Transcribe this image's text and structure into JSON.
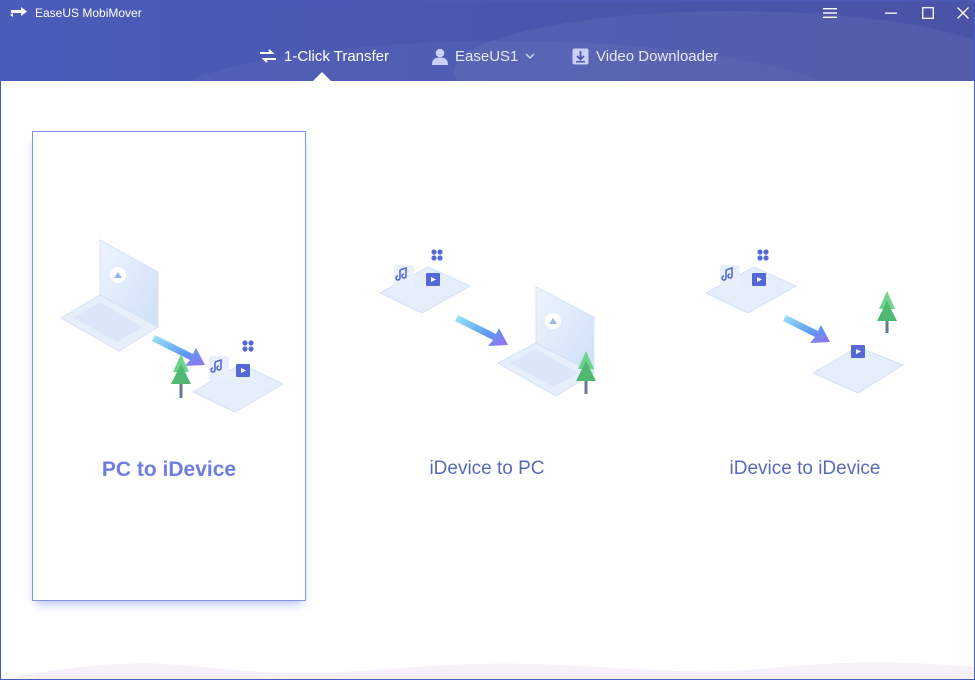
{
  "window": {
    "title": "EaseUS MobiMover"
  },
  "nav": {
    "transfer": "1-Click Transfer",
    "account": "EaseUS1",
    "video": "Video Downloader"
  },
  "cards": [
    {
      "label": "PC to iDevice",
      "selected": true
    },
    {
      "label": "iDevice to PC",
      "selected": false
    },
    {
      "label": "iDevice to iDevice",
      "selected": false
    }
  ],
  "colors": {
    "header": "#4a56ad",
    "accent": "#6e7de0",
    "label": "#5a6ab6"
  }
}
